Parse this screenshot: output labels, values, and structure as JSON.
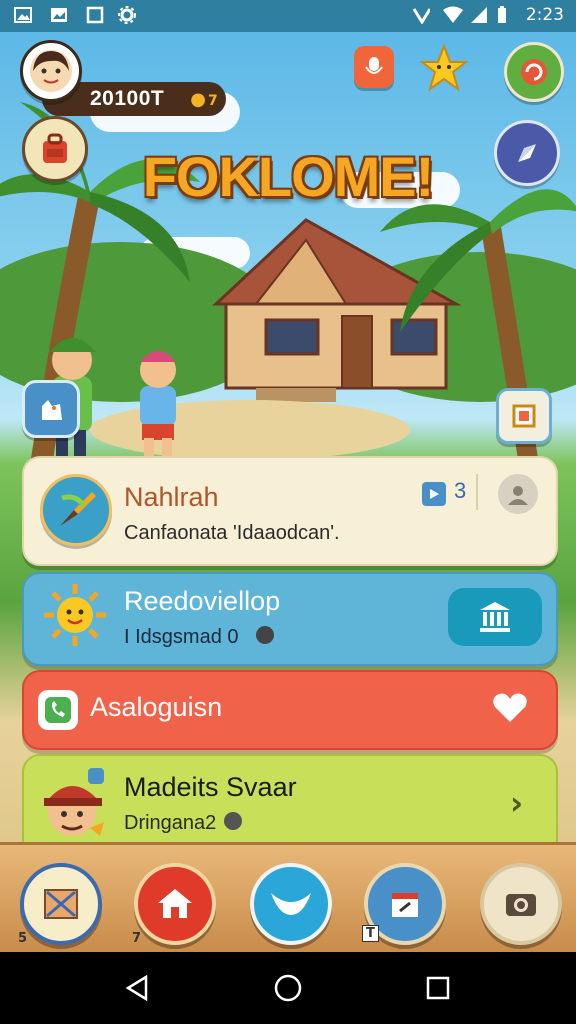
{
  "status_bar": {
    "time": "2:23",
    "left_icons": [
      "image-icon",
      "picture-icon",
      "square-icon",
      "gear-icon"
    ],
    "right_icons": [
      "vpn-key-icon",
      "wifi-icon",
      "signal-icon",
      "battery-icon"
    ]
  },
  "header": {
    "score": "20100T",
    "score_badge": "7"
  },
  "title": "FOKLOME!",
  "cards": [
    {
      "title": "Nahlrah",
      "subtitle": "Canfaonata 'Idaaodcan'.",
      "badge_count": "3",
      "color": "#f7f0d6"
    },
    {
      "title": "Reedoviellop",
      "subtitle": "I Idsgsmad 0",
      "color": "#5fb5d8"
    },
    {
      "title": "Asaloguisn",
      "color": "#f0634a"
    },
    {
      "title": "Madeits Svaar",
      "subtitle": "Dringana2",
      "color": "#c8df5a"
    }
  ],
  "bottom_nav": {
    "tag_1": "5",
    "tag_2": "7",
    "tag_4": "T"
  },
  "colors": {
    "status_bar": "#2f7fa0",
    "title_fill": "#f5a623",
    "title_outline": "#7a3b10",
    "nav_bar": "#d9a060"
  }
}
